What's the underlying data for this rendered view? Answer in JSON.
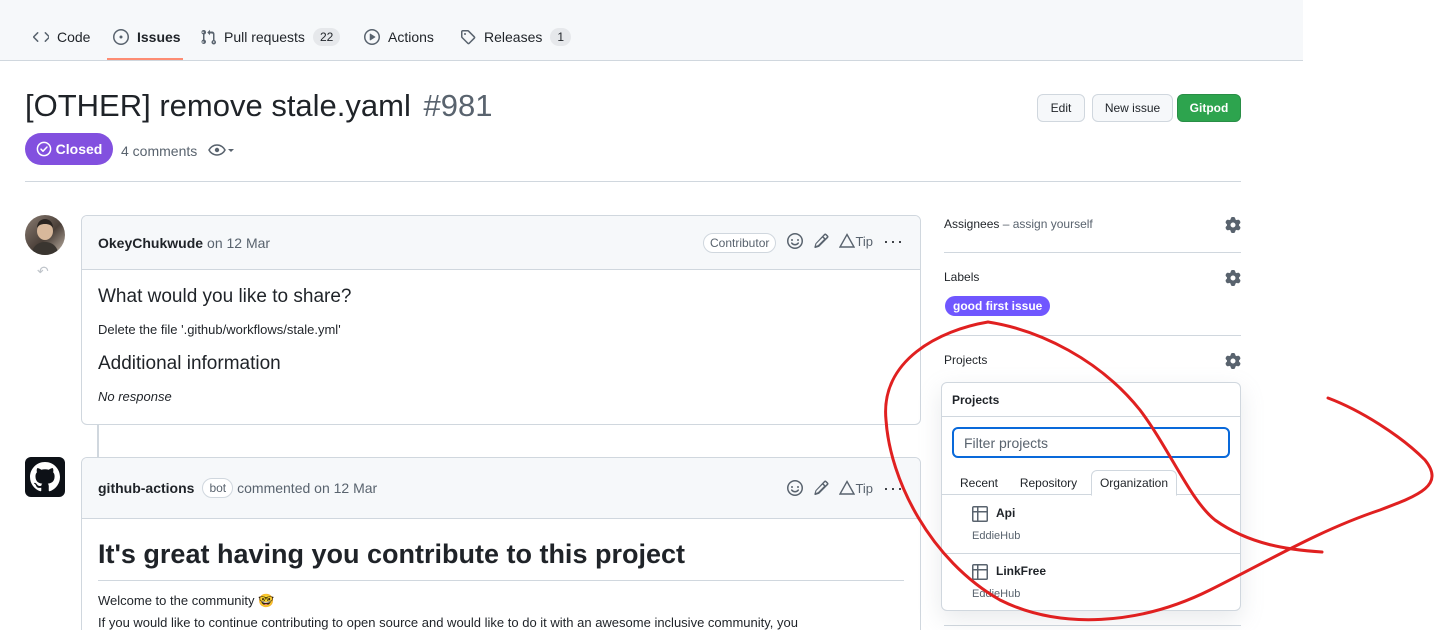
{
  "nav": {
    "tabs": [
      {
        "label": "Code",
        "icon": "code-icon"
      },
      {
        "label": "Issues",
        "icon": "issue-icon"
      },
      {
        "label": "Pull requests",
        "icon": "pull-request-icon",
        "count": "22"
      },
      {
        "label": "Actions",
        "icon": "play-icon"
      },
      {
        "label": "Releases",
        "icon": "tag-icon",
        "count": "1"
      }
    ]
  },
  "issue": {
    "title": "[OTHER] remove stale.yaml",
    "number": "#981",
    "state": "Closed",
    "comments_count": "4 comments",
    "buttons": {
      "edit": "Edit",
      "new_issue": "New issue",
      "gitpod": "Gitpod"
    }
  },
  "comments": [
    {
      "author": "OkeyChukwude",
      "meta": "on 12 Mar",
      "role": "Contributor",
      "tip": "Tip",
      "heading1": "What would you like to share?",
      "text1": "Delete the file '.github/workflows/stale.yml'",
      "heading2": "Additional information",
      "text2": "No response"
    },
    {
      "author": "github-actions",
      "badge": "bot",
      "meta": "commented on 12 Mar",
      "tip": "Tip",
      "heading": "It's great having you contribute to this project",
      "line1": "Welcome to the community 🤓",
      "line2": "If you would like to continue contributing to open source and would like to do it with an awesome inclusive community, you"
    }
  ],
  "sidebar": {
    "assignees_title": "Assignees",
    "assignees_hint": " – assign yourself",
    "labels_title": "Labels",
    "label": "good first issue",
    "projects_title": "Projects"
  },
  "projects_popover": {
    "title": "Projects",
    "filter_placeholder": "Filter projects",
    "tabs": [
      "Recent",
      "Repository",
      "Organization"
    ],
    "active_tab": "Organization",
    "items": [
      {
        "name": "Api",
        "owner": "EddieHub"
      },
      {
        "name": "LinkFree",
        "owner": "EddieHub"
      }
    ]
  },
  "colors": {
    "closed_purple": "#8250df",
    "label_purple": "#7057ff",
    "gitpod_green": "#2da44e",
    "annotation_red": "#e02020",
    "tab_underline": "#fd8c73"
  }
}
